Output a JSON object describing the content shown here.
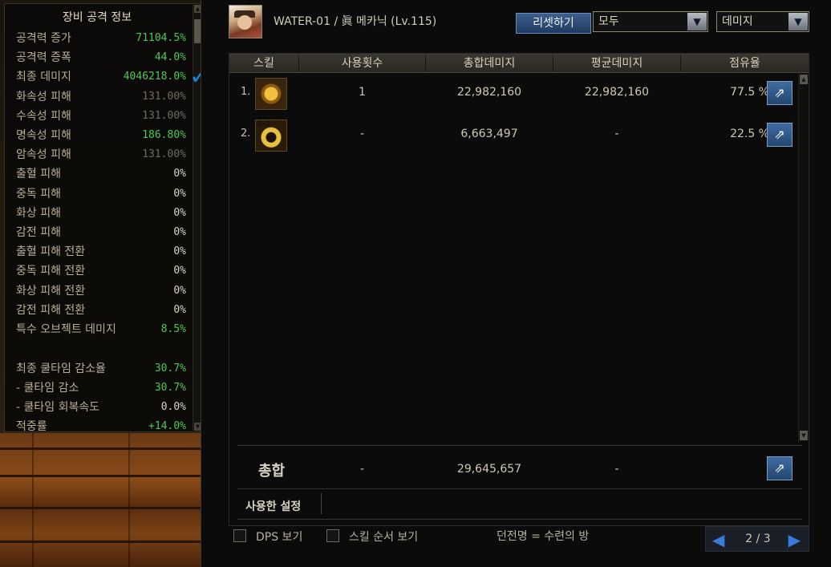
{
  "left_panel": {
    "title": "장비 공격 정보",
    "stats": [
      {
        "label": "공격력 증가",
        "value": "71104.5%",
        "color": "green"
      },
      {
        "label": "공격력 증폭",
        "value": "44.0%",
        "color": "green"
      },
      {
        "label": "최종 데미지",
        "value": "4046218.0%",
        "color": "green"
      },
      {
        "label": "화속성 피해",
        "value": "131.00%",
        "color": "gray"
      },
      {
        "label": "수속성 피해",
        "value": "131.00%",
        "color": "gray"
      },
      {
        "label": "명속성 피해",
        "value": "186.80%",
        "color": "green"
      },
      {
        "label": "암속성 피해",
        "value": "131.00%",
        "color": "gray"
      },
      {
        "label": "출혈 피해",
        "value": "0%",
        "color": "white"
      },
      {
        "label": "중독 피해",
        "value": "0%",
        "color": "white"
      },
      {
        "label": "화상 피해",
        "value": "0%",
        "color": "white"
      },
      {
        "label": "감전 피해",
        "value": "0%",
        "color": "white"
      },
      {
        "label": "출혈 피해 전환",
        "value": "0%",
        "color": "white"
      },
      {
        "label": "중독 피해 전환",
        "value": "0%",
        "color": "white"
      },
      {
        "label": "화상 피해 전환",
        "value": "0%",
        "color": "white"
      },
      {
        "label": "감전 피해 전환",
        "value": "0%",
        "color": "white"
      },
      {
        "label": "특수 오브젝트 데미지",
        "value": "8.5%",
        "color": "green"
      },
      {
        "label": "최종 쿨타임 감소율",
        "value": "30.7%",
        "color": "green"
      },
      {
        "label": "- 쿨타임 감소",
        "value": "30.7%",
        "color": "green"
      },
      {
        "label": "- 쿨타임 회복속도",
        "value": "0.0%",
        "color": "white"
      },
      {
        "label": "적중률",
        "value": "+14.0%",
        "color": "green"
      }
    ]
  },
  "header": {
    "character": "WATER-01 / 眞 메카닉 (Lv.115)",
    "reset_label": "리셋하기",
    "filter_value": "모두",
    "sort_value": "데미지"
  },
  "table": {
    "columns": [
      "스킬",
      "사용횟수",
      "총합데미지",
      "평균데미지",
      "점유율"
    ],
    "rows": [
      {
        "index": "1.",
        "uses": "1",
        "total": "22,982,160",
        "avg": "22,982,160",
        "share": "77.5 %"
      },
      {
        "index": "2.",
        "uses": "-",
        "total": "6,663,497",
        "avg": "-",
        "share": "22.5 %"
      }
    ],
    "total": {
      "label": "총합",
      "uses": "-",
      "total": "29,645,657",
      "avg": "-"
    },
    "settings_label": "사용한 설정"
  },
  "footer": {
    "dps_label": "DPS 보기",
    "skill_order_label": "스킬 순서 보기",
    "dungeon_text": "던전명 = 수련의 방",
    "page_text": "2 / 3"
  },
  "colors": {
    "green": "#4fc84f",
    "gray": "#6f6a60",
    "accent_blue": "#3a7ad8",
    "check": "#1e7fd8"
  }
}
